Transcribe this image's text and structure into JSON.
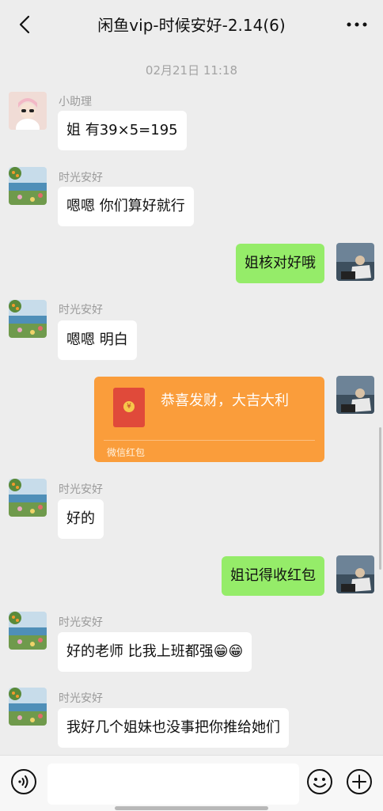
{
  "header": {
    "title": "闲鱼vip-时候安好-2.14(6)",
    "back_icon": "chevron-left-icon",
    "more_icon": "more-dots-icon"
  },
  "timestamp": "02月21日 11:18",
  "messages": [
    {
      "side": "left",
      "sender": "小助理",
      "text": "姐 有39×5=195"
    },
    {
      "side": "left",
      "sender": "时光安好",
      "text": "嗯嗯 你们算好就行"
    },
    {
      "side": "right",
      "text": "姐核对好哦"
    },
    {
      "side": "left",
      "sender": "时光安好",
      "text": "嗯嗯  明白"
    },
    {
      "side": "right",
      "type": "red-packet",
      "text": "恭喜发财，大吉大利",
      "label": "微信红包"
    },
    {
      "side": "left",
      "sender": "时光安好",
      "text": "好的"
    },
    {
      "side": "right",
      "text": "姐记得收红包"
    },
    {
      "side": "left",
      "sender": "时光安好",
      "text": "好的老师  比我上班都强😁😁"
    },
    {
      "side": "left",
      "sender": "时光安好",
      "text": "我好几个姐妹也没事把你推给她们"
    }
  ],
  "colors": {
    "background": "#ededed",
    "bubble_mine": "#95ec69",
    "bubble_other": "#ffffff",
    "red_packet": "#fa9d3b"
  },
  "input": {
    "value": "",
    "voice_icon": "voice-icon",
    "emoji_icon": "emoji-icon",
    "plus_icon": "plus-icon"
  }
}
